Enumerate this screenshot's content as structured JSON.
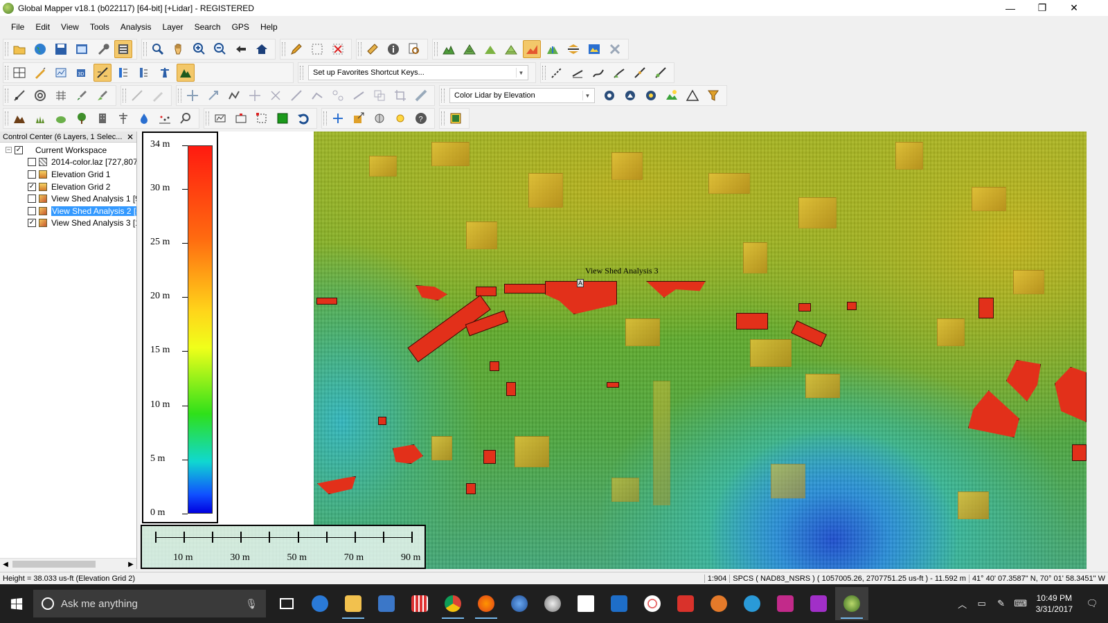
{
  "window": {
    "title": "Global Mapper v18.1 (b022117) [64-bit] [+Lidar] - REGISTERED",
    "minimize": "—",
    "maximize": "❐",
    "close": "✕"
  },
  "menu": [
    "File",
    "Edit",
    "View",
    "Tools",
    "Analysis",
    "Layer",
    "Search",
    "GPS",
    "Help"
  ],
  "toolbar": {
    "favorites_combo": "Set up Favorites Shortcut Keys...",
    "lidar_combo": "Color Lidar by Elevation"
  },
  "control_center": {
    "title": "Control Center (6 Layers, 1 Selec...",
    "close": "✕",
    "workspace": "Current Workspace",
    "layers": [
      {
        "label": "2014-color.laz [727,807",
        "checked": false,
        "icon": "lidar-icon",
        "selected": false
      },
      {
        "label": "Elevation Grid 1",
        "checked": false,
        "icon": "grid-icon",
        "selected": false
      },
      {
        "label": "Elevation Grid 2",
        "checked": true,
        "icon": "grid-icon",
        "selected": false
      },
      {
        "label": "View Shed Analysis 1 [9",
        "checked": false,
        "icon": "viewshed-icon",
        "selected": false
      },
      {
        "label": "View Shed Analysis 2 [3",
        "checked": false,
        "icon": "viewshed-icon",
        "selected": true
      },
      {
        "label": "View Shed Analysis 3 [1",
        "checked": true,
        "icon": "viewshed-icon",
        "selected": false
      }
    ]
  },
  "legend": {
    "labels": [
      "34 m",
      "30 m",
      "25 m",
      "20 m",
      "15 m",
      "10 m",
      "5 m",
      "0 m"
    ],
    "values_m": [
      34,
      30,
      25,
      20,
      15,
      10,
      5,
      0
    ]
  },
  "scale_bar": {
    "labels": [
      "10 m",
      "30 m",
      "50 m",
      "70 m",
      "90 m"
    ]
  },
  "map": {
    "viewshed_label": "View Shed Analysis 3"
  },
  "status": {
    "left": "Height = 38.033 us-ft (Elevation Grid 2)",
    "scale": "1:904",
    "projection": "SPCS ( NAD83_NSRS ) ( 1057005.26, 2707751.25 us-ft ) - 11.592 m",
    "latlon": "41° 40' 07.3587\" N, 70° 01' 58.3451\" W"
  },
  "taskbar": {
    "search_placeholder": "Ask me anything",
    "time": "10:49 PM",
    "date": "3/31/2017",
    "notifications": "1"
  },
  "colors": {
    "viewshed": "#e2301a",
    "selection": "#3399ff",
    "taskbar": "#1f1f1f"
  }
}
